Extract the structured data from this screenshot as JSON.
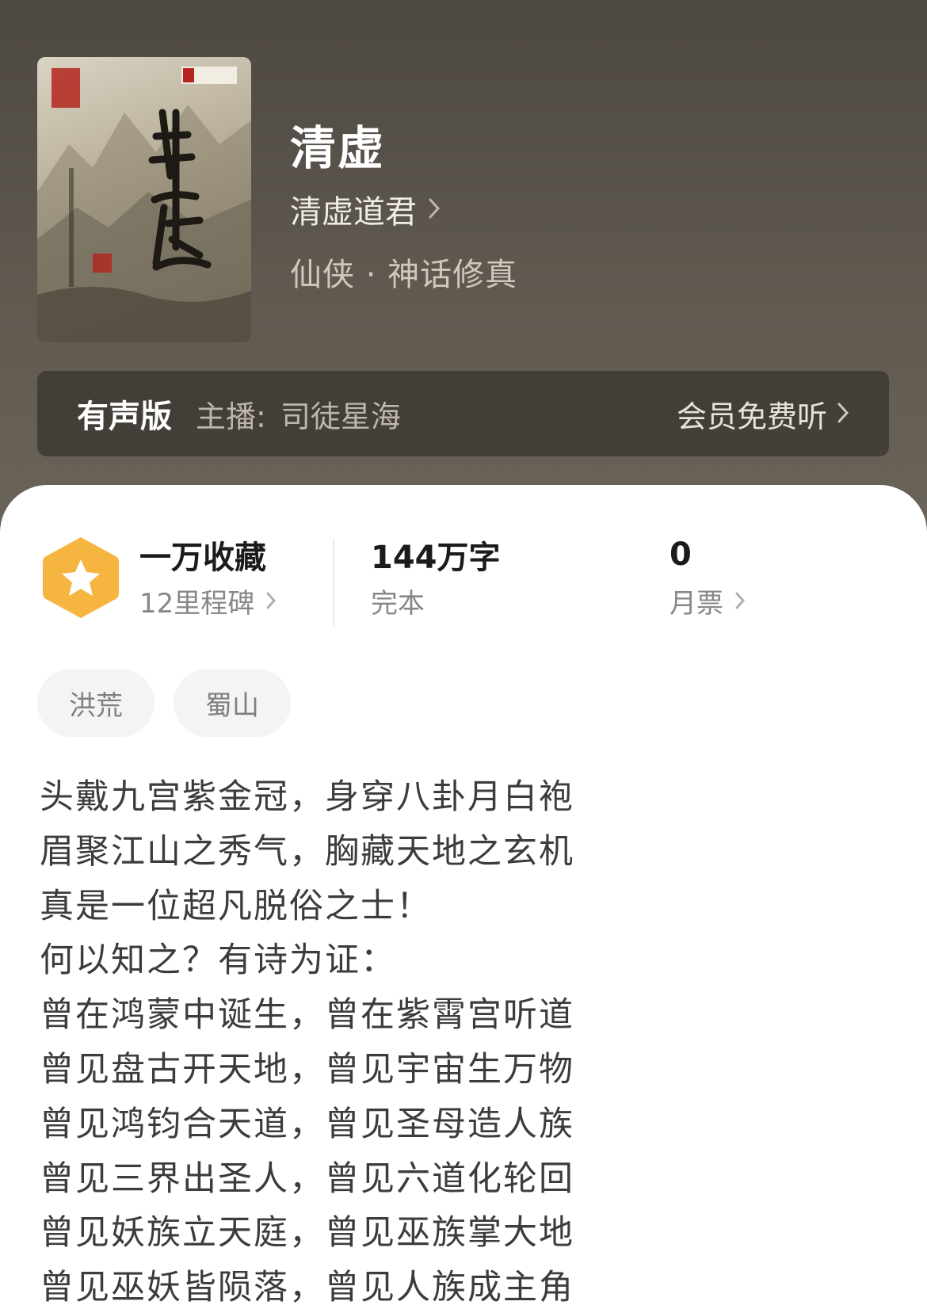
{
  "book": {
    "title": "清虚",
    "author": "清虚道君",
    "category": "仙侠 · 神话修真"
  },
  "audio": {
    "label": "有声版",
    "narrator_prefix": "主播:",
    "narrator": "司徒星海",
    "free_label": "会员免费听"
  },
  "stats": {
    "favorites": {
      "value": "一万收藏",
      "label": "12里程碑"
    },
    "words": {
      "value": "144万字",
      "label": "完本"
    },
    "votes": {
      "value": "0",
      "label": "月票"
    }
  },
  "tags": [
    "洪荒",
    "蜀山"
  ],
  "description": [
    "头戴九宫紫金冠，身穿八卦月白袍",
    "眉聚江山之秀气，胸藏天地之玄机",
    "真是一位超凡脱俗之士！",
    "何以知之？有诗为证：",
    "曾在鸿蒙中诞生，曾在紫霄宫听道",
    "曾见盘古开天地，曾见宇宙生万物",
    "曾见鸿钧合天道，曾见圣母造人族",
    "曾见三界出圣人，曾见六道化轮回",
    "曾见妖族立天庭，曾见巫族掌大地",
    "曾见巫妖皆陨落，曾见人族成主角"
  ],
  "colors": {
    "header_bg": "#5a544c",
    "badge": "#f5b540",
    "text_dark": "#1b1b1b",
    "text_gray": "#888888"
  }
}
